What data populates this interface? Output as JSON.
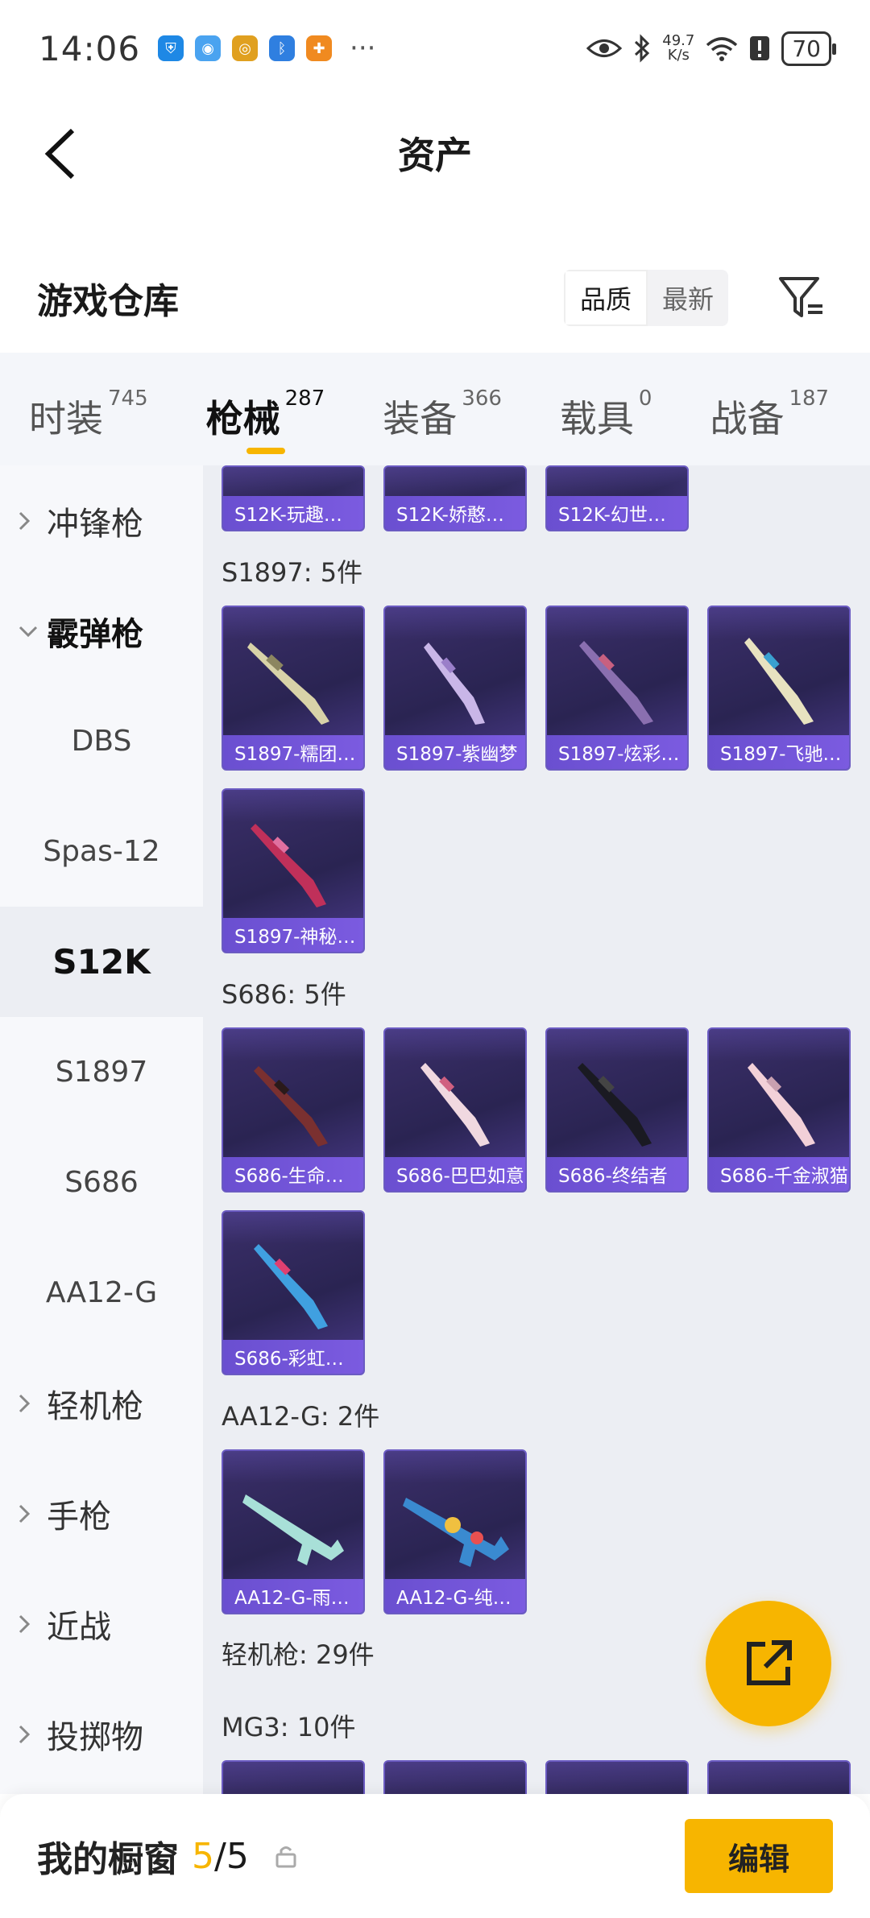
{
  "status_bar": {
    "time": "14:06",
    "net_speed_value": "49.7",
    "net_speed_unit": "K/s",
    "battery": "70"
  },
  "header": {
    "title": "资产"
  },
  "warehouse": {
    "title": "游戏仓库",
    "sort_options": [
      "品质",
      "最新"
    ],
    "active_sort": "品质"
  },
  "tabs": [
    {
      "label": "时装",
      "count": "745"
    },
    {
      "label": "枪械",
      "count": "287"
    },
    {
      "label": "装备",
      "count": "366"
    },
    {
      "label": "载具",
      "count": "0"
    },
    {
      "label": "战备",
      "count": "187"
    }
  ],
  "active_tab": "枪械",
  "sidebar": [
    {
      "label": "冲锋枪",
      "kind": "parent",
      "expanded": false
    },
    {
      "label": "霰弹枪",
      "kind": "parent",
      "expanded": true
    },
    {
      "label": "DBS",
      "kind": "child"
    },
    {
      "label": "Spas-12",
      "kind": "child"
    },
    {
      "label": "S12K",
      "kind": "child",
      "selected": true
    },
    {
      "label": "S1897",
      "kind": "child"
    },
    {
      "label": "S686",
      "kind": "child"
    },
    {
      "label": "AA12-G",
      "kind": "child"
    },
    {
      "label": "轻机枪",
      "kind": "parent",
      "expanded": false
    },
    {
      "label": "手枪",
      "kind": "parent",
      "expanded": false
    },
    {
      "label": "近战",
      "kind": "parent",
      "expanded": false
    },
    {
      "label": "投掷物",
      "kind": "parent",
      "expanded": false
    }
  ],
  "content": {
    "s12k_partial": [
      "S12K-玩趣…",
      "S12K-娇憨…",
      "S12K-幻世…"
    ],
    "groups": [
      {
        "title": "S1897: 5件",
        "items": [
          "S1897-糯团…",
          "S1897-紫幽梦",
          "S1897-炫彩…",
          "S1897-飞驰…",
          "S1897-神秘…"
        ]
      },
      {
        "title": "S686: 5件",
        "items": [
          "S686-生命…",
          "S686-巴巴如意",
          "S686-终结者",
          "S686-千金淑猫",
          "S686-彩虹…"
        ]
      },
      {
        "title": "AA12-G: 2件",
        "items": [
          "AA12-G-雨…",
          "AA12-G-纯…"
        ]
      }
    ],
    "lmg_title": "轻机枪: 29件",
    "mg3_title": "MG3: 10件"
  },
  "bottom_bar": {
    "title": "我的橱窗",
    "current": "5",
    "separator": "/",
    "total": "5",
    "edit_label": "编辑"
  },
  "colors": {
    "accent": "#f7b500",
    "card_caption": "#6a4fd0",
    "card_bg": "#2a2452"
  }
}
